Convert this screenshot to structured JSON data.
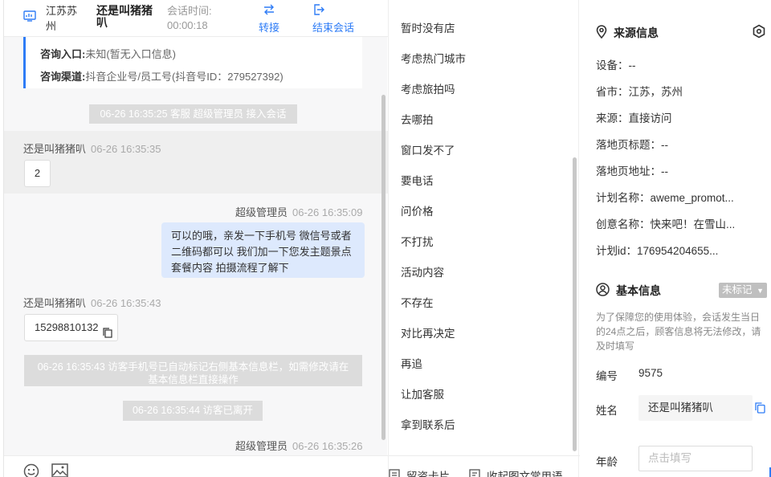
{
  "header": {
    "location": "江苏苏州",
    "visitor_name": "还是叫猪猪叭",
    "session_time_label": "会话时间:",
    "session_time": "00:00:18",
    "transfer_label": "转接",
    "end_label": "结束会话"
  },
  "info_card": {
    "entry_label": "咨询入口:",
    "entry_value": "未知(暂无入口信息)",
    "channel_label": "咨询渠道:",
    "channel_value": "抖音企业号/员工号(抖音号ID：279527392)"
  },
  "messages": {
    "sys_join": "06-26 16:35:25 客服 超级管理员 接入会话",
    "visitor1_name": "还是叫猪猪叭",
    "visitor1_time": "06-26 16:35:35",
    "visitor1_text": "2",
    "agent1_name": "超级管理员",
    "agent1_time": "06-26 16:35:09",
    "agent1_text": "可以的哦，亲发一下手机号 微信号或者二维码都可以 我们加一下您发主题景点套餐内容 拍摄流程了解下",
    "visitor2_name": "还是叫猪猪叭",
    "visitor2_time": "06-26 16:35:43",
    "visitor2_text": "15298810132",
    "sys_phone": "06-26 16:35:43 访客手机号已自动标记右侧基本信息栏，如需修改请在基本信息栏直接操作",
    "sys_left": "06-26 16:35:44 访客已离开",
    "agent2_name": "超级管理员",
    "agent2_time": "06-26 16:35:26"
  },
  "quick_replies": [
    "暂时没有店",
    "考虑热门城市",
    "考虑旅拍吗",
    "去哪拍",
    "窗口发不了",
    "要电话",
    "问价格",
    "不打扰",
    "活动内容",
    "不存在",
    "对比再决定",
    "再追",
    "让加客服",
    "拿到联系后"
  ],
  "quick_footer": {
    "card_label": "留资卡片",
    "collapse_label": "收起图文常用语"
  },
  "source": {
    "title": "来源信息",
    "device": "设备：--",
    "province": "省市：江苏，苏州",
    "origin": "来源：直接访问",
    "landing_title": "落地页标题：--",
    "landing_url": "落地页地址：--",
    "plan_name": "计划名称：aweme_promot...",
    "creative_name": "创意名称：快来吧！在雪山...",
    "plan_id": "计划id：176954204655..."
  },
  "basic": {
    "title": "基本信息",
    "tag": "未标记",
    "note": "为了保障您的使用体验，会话发生当日的24点之后，顾客信息将无法修改，请及时填写",
    "id_label": "编号",
    "id_value": "9575",
    "name_label": "姓名",
    "name_value": "还是叫猪猪叭",
    "age_label": "年龄",
    "age_placeholder": "点击填写"
  },
  "colors": {
    "accent": "#2e7cf6",
    "agent_bubble": "#dde9fd",
    "system_msg": "#dcdcdc"
  }
}
